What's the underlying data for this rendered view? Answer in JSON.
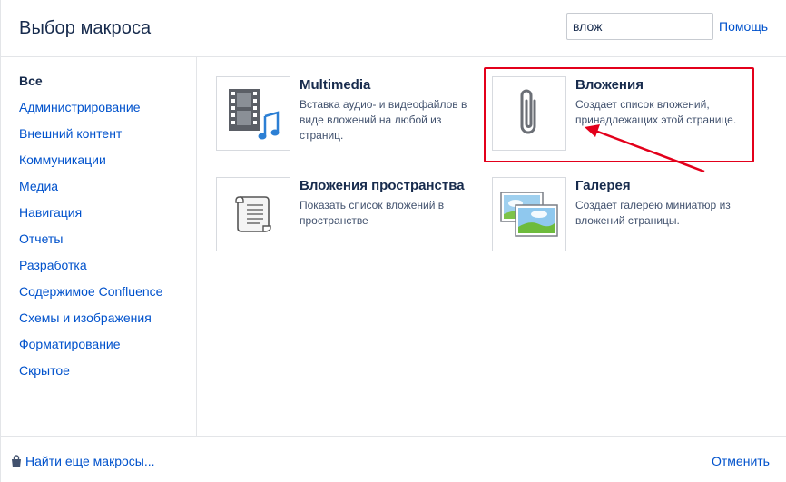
{
  "header": {
    "title": "Выбор макроса",
    "search_value": "влож",
    "help_label": "Помощь"
  },
  "sidebar": {
    "items": [
      {
        "label": "Все",
        "active": true
      },
      {
        "label": "Администрирование"
      },
      {
        "label": "Внешний контент"
      },
      {
        "label": "Коммуникации"
      },
      {
        "label": "Медиа"
      },
      {
        "label": "Навигация"
      },
      {
        "label": "Отчеты"
      },
      {
        "label": "Разработка"
      },
      {
        "label": "Содержимое Confluence"
      },
      {
        "label": "Схемы и изображения"
      },
      {
        "label": "Форматирование"
      },
      {
        "label": "Скрытое"
      }
    ]
  },
  "macros": [
    {
      "name": "Multimedia",
      "description": "Вставка аудио- и видеофайлов в виде вложений на любой из страниц.",
      "icon": "film-music-icon"
    },
    {
      "name": "Вложения",
      "description": "Создает список вложений, принадлежащих этой странице.",
      "icon": "paperclip-icon"
    },
    {
      "name": "Вложения пространства",
      "description": "Показать список вложений в пространстве",
      "icon": "scroll-document-icon"
    },
    {
      "name": "Галерея",
      "description": "Создает галерею миниатюр из вложений страницы.",
      "icon": "gallery-images-icon"
    }
  ],
  "annotation": {
    "color": "#e3001b"
  },
  "footer": {
    "find_more_label": "Найти еще макросы...",
    "cancel_label": "Отменить"
  }
}
